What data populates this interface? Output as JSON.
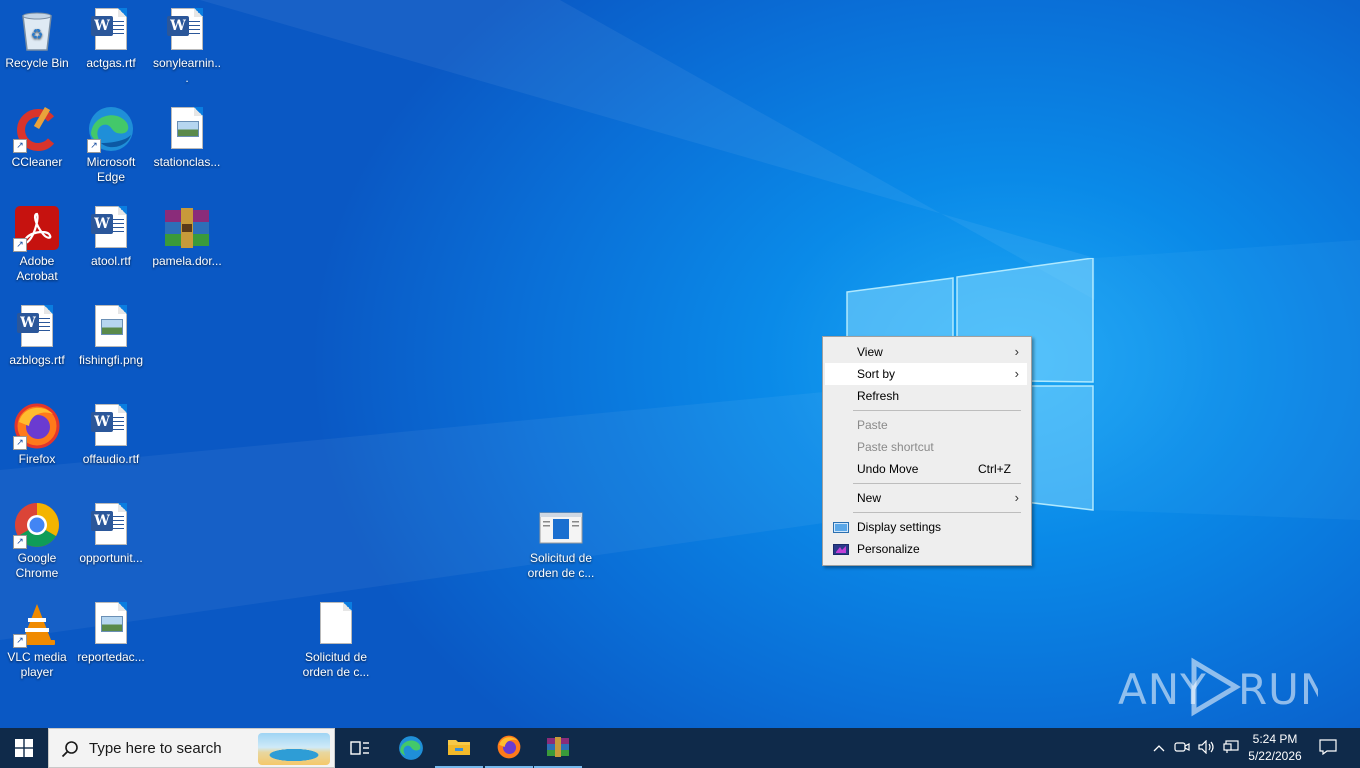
{
  "desktop_icons": [
    {
      "label": "Recycle Bin",
      "icon": "recycle-bin-icon"
    },
    {
      "label": "actgas.rtf",
      "icon": "word-document-icon"
    },
    {
      "label": "sonylearnin...",
      "icon": "word-document-icon"
    },
    {
      "label": "CCleaner",
      "icon": "ccleaner-icon"
    },
    {
      "label": "Microsoft Edge",
      "icon": "edge-icon"
    },
    {
      "label": "stationclas...",
      "icon": "image-file-icon"
    },
    {
      "label": "Adobe Acrobat",
      "icon": "acrobat-icon"
    },
    {
      "label": "atool.rtf",
      "icon": "word-document-icon"
    },
    {
      "label": "pamela.dor...",
      "icon": "winrar-archive-icon"
    },
    {
      "label": "azblogs.rtf",
      "icon": "word-document-icon"
    },
    {
      "label": "fishingfi.png",
      "icon": "image-file-icon"
    },
    {
      "label": "Firefox",
      "icon": "firefox-icon"
    },
    {
      "label": "offaudio.rtf",
      "icon": "word-document-icon"
    },
    {
      "label": "Google Chrome",
      "icon": "chrome-icon"
    },
    {
      "label": "opportunit...",
      "icon": "word-document-icon"
    },
    {
      "label": "Solicitud de orden de c...",
      "icon": "executable-file-icon"
    },
    {
      "label": "VLC media player",
      "icon": "vlc-icon"
    },
    {
      "label": "reportedac...",
      "icon": "image-file-icon"
    },
    {
      "label": "Solicitud de orden de c...",
      "icon": "blank-file-icon"
    }
  ],
  "context_menu": {
    "view": "View",
    "sort_by": "Sort by",
    "refresh": "Refresh",
    "paste": "Paste",
    "paste_shortcut": "Paste shortcut",
    "undo_move": "Undo Move",
    "undo_move_shortcut": "Ctrl+Z",
    "new": "New",
    "display_settings": "Display settings",
    "personalize": "Personalize",
    "highlighted_item": "Sort by"
  },
  "taskbar": {
    "search_placeholder": "Type here to search",
    "apps": [
      "Task View",
      "Microsoft Edge",
      "File Explorer",
      "Firefox",
      "WinRAR"
    ],
    "clock_time": "5:24 PM",
    "clock_date": "5/22/2026"
  },
  "watermark": "ANY RUN",
  "colors": {
    "desktop_accent": "#0a78dc",
    "taskbar_bg": "#0f2a4a",
    "menu_bg": "#eeeeee"
  }
}
